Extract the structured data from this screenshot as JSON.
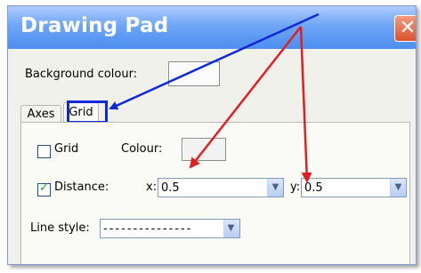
{
  "window": {
    "title": "Drawing Pad",
    "close_glyph": "✕"
  },
  "background": {
    "label": "Background colour:"
  },
  "tabs": [
    {
      "label": "Axes"
    },
    {
      "label": "Grid"
    }
  ],
  "grid_panel": {
    "grid_label": "Grid",
    "grid_checked": false,
    "colour_label": "Colour:",
    "distance_label": "Distance:",
    "distance_checked": true,
    "x_label": "x:",
    "x_value": "0.5",
    "y_label": "y:",
    "y_value": "0.5",
    "line_style_label": "Line style:",
    "line_style_value": "---------------",
    "check_glyph": "✓",
    "dropdown_glyph": "▼"
  },
  "annotations": {
    "blue_color": "#1028d8",
    "red_color": "#e02020"
  }
}
